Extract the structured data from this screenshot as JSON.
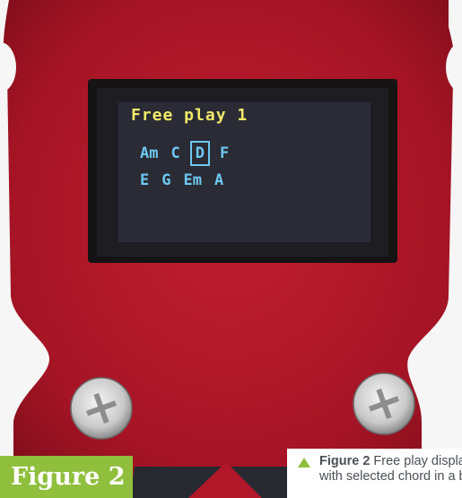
{
  "oled": {
    "title": "Free play 1",
    "chords_row1": [
      "Am",
      "C",
      "D",
      "F"
    ],
    "chords_row2": [
      "E",
      "G",
      "Em",
      "A"
    ],
    "selected_chord": "D",
    "colors": {
      "title": "#f2e96a",
      "chords": "#6ec8f2",
      "screen": "#2a2b34"
    }
  },
  "figure_label": "Figure 2",
  "caption": {
    "bold": "Figure 2",
    "text": " Free play display with selected chord in a box"
  },
  "colors": {
    "enclosure": "#b0182a",
    "accent": "#8fbf3c"
  }
}
